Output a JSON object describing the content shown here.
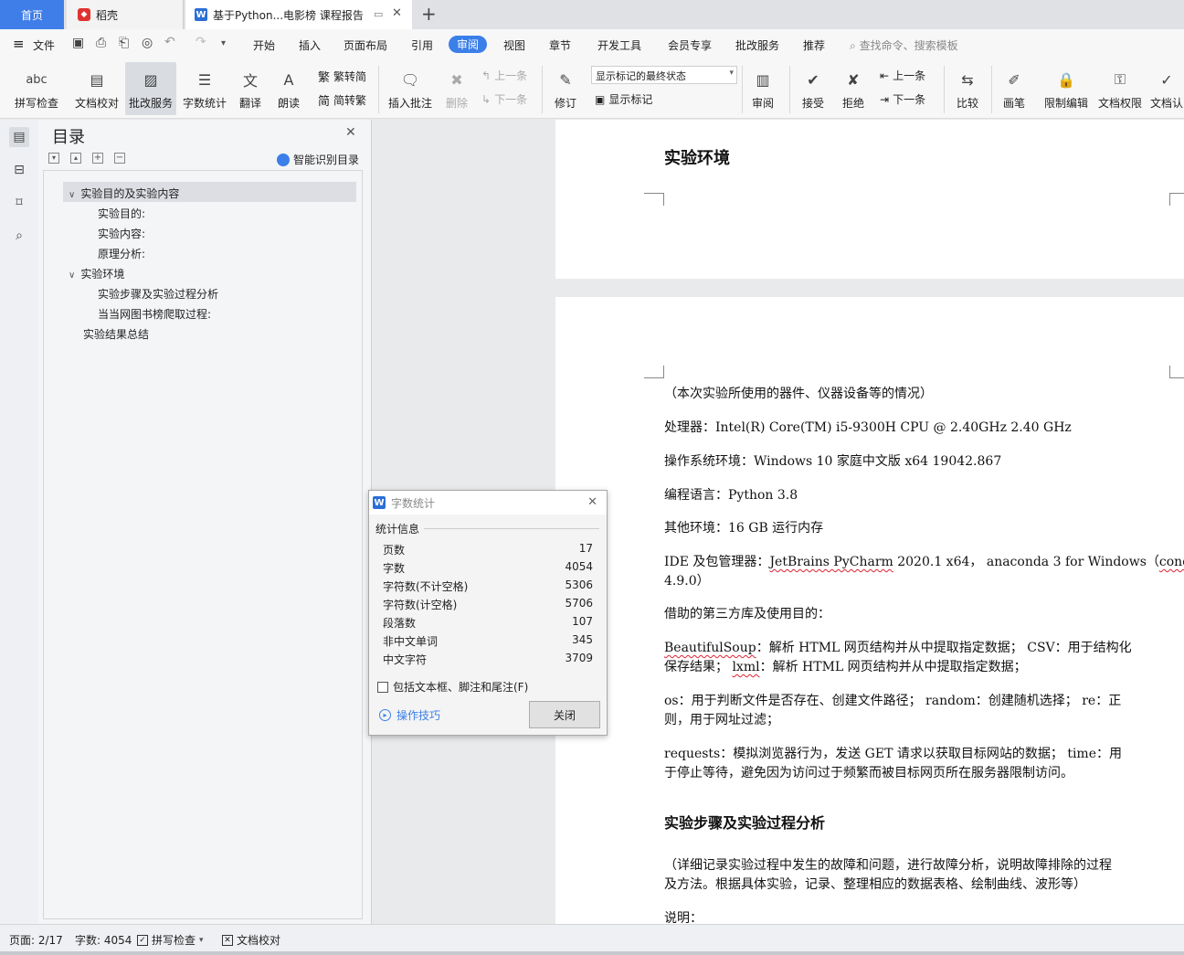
{
  "tabs": {
    "home": "首页",
    "daoke": "稻壳",
    "doc": "基于Python...电影榜 课程报告",
    "new_tab": "+"
  },
  "menu": {
    "file": "文件",
    "items": [
      "开始",
      "插入",
      "页面布局",
      "引用",
      "审阅",
      "视图",
      "章节",
      "开发工具",
      "会员专享",
      "批改服务",
      "推荐"
    ],
    "search_placeholder": "查找命令、搜索模板"
  },
  "toolbar": {
    "spellcheck": "拼写检查",
    "doc_proof": "文档校对",
    "correction_service": "批改服务",
    "word_count": "字数统计",
    "translate": "翻译",
    "read_aloud": "朗读",
    "trad_to_simp": "繁转简",
    "simp_to_trad": "简转繁",
    "insert_comment": "插入批注",
    "delete": "删除",
    "prev_comment": "上一条",
    "next_comment": "下一条",
    "revise": "修订",
    "markup_state": "显示标记的最终状态",
    "show_markup": "显示标记",
    "review": "审阅",
    "accept": "接受",
    "reject": "拒绝",
    "prev_change": "上一条",
    "next_change": "下一条",
    "compare": "比较",
    "pen": "画笔",
    "restrict_edit": "限制编辑",
    "doc_permission": "文档权限",
    "doc_verify": "文档认"
  },
  "toc": {
    "title": "目录",
    "smart_detect": "智能识别目录",
    "items": [
      {
        "label": "实验目的及实验内容",
        "level": 1
      },
      {
        "label": "实验目的:",
        "level": 2
      },
      {
        "label": "实验内容:",
        "level": 2
      },
      {
        "label": "原理分析:",
        "level": 2
      },
      {
        "label": "实验环境",
        "level": 1
      },
      {
        "label": "实验步骤及实验过程分析",
        "level": 2
      },
      {
        "label": "当当网图书榜爬取过程:",
        "level": 2
      },
      {
        "label": "实验结果总结",
        "level": 1
      }
    ]
  },
  "document": {
    "heading_env": "实验环境",
    "p_intro": "（本次实验所使用的器件、仪器设备等的情况）",
    "p_cpu": "处理器：Intel(R) Core(TM) i5-9300H CPU @ 2.40GHz 2.40 GHz",
    "p_os": "操作系统环境：Windows 10  家庭中文版  x64 19042.867",
    "p_lang": "编程语言：Python 3.8",
    "p_other": "其他环境：16 GB  运行内存",
    "p_ide_1": "IDE  及包管理器：",
    "p_ide_jb": "JetBrains PyCharm",
    "p_ide_2": " 2020.1 x64， anaconda 3 for Windows（",
    "p_ide_conda": "conda",
    "p_ide_3": "4.9.0）",
    "p_libs": "借助的第三方库及使用目的：",
    "p_bs_1": "BeautifulSoup",
    "p_bs_2": "：解析  HTML  网页结构并从中提取指定数据；  CSV：用于结构化",
    "p_bs_3": "保存结果；  ",
    "p_bs_lxml": "lxml",
    "p_bs_4": "：解析  HTML  网页结构并从中提取指定数据；",
    "p_os_1": "os：用于判断文件是否存在、创建文件路径；  random：创建随机选择；  re：正",
    "p_os_2": "则，用于网址过滤；",
    "p_req_1": "requests：模拟浏览器行为，发送  GET  请求以获取目标网站的数据；  time：用",
    "p_req_2": "于停止等待，避免因为访问过于频繁而被目标网页所在服务器限制访问。",
    "heading_steps": "实验步骤及实验过程分析",
    "p_detail_1": "（详细记录实验过程中发生的故障和问题，进行故障分析，说明故障排除的过程",
    "p_detail_2": "及方法。根据具体实验，记录、整理相应的数据表格、绘制曲线、波形等）",
    "p_note": "说明："
  },
  "dialog": {
    "title": "字数统计",
    "section": "统计信息",
    "stats": [
      {
        "label": "页数",
        "value": "17"
      },
      {
        "label": "字数",
        "value": "4054"
      },
      {
        "label": "字符数(不计空格)",
        "value": "5306"
      },
      {
        "label": "字符数(计空格)",
        "value": "5706"
      },
      {
        "label": "段落数",
        "value": "107"
      },
      {
        "label": "非中文单词",
        "value": "345"
      },
      {
        "label": "中文字符",
        "value": "3709"
      }
    ],
    "include_label": "包括文本框、脚注和尾注(F)",
    "tips": "操作技巧",
    "close": "关闭"
  },
  "status": {
    "page": "页面: 2/17",
    "words": "字数: 4054",
    "spellcheck": "拼写检查",
    "doc_proof": "文档校对"
  },
  "colors": {
    "accent": "#3b7fe8",
    "brand_daoke": "#e0332f",
    "spell_underline": "#dd2233"
  }
}
